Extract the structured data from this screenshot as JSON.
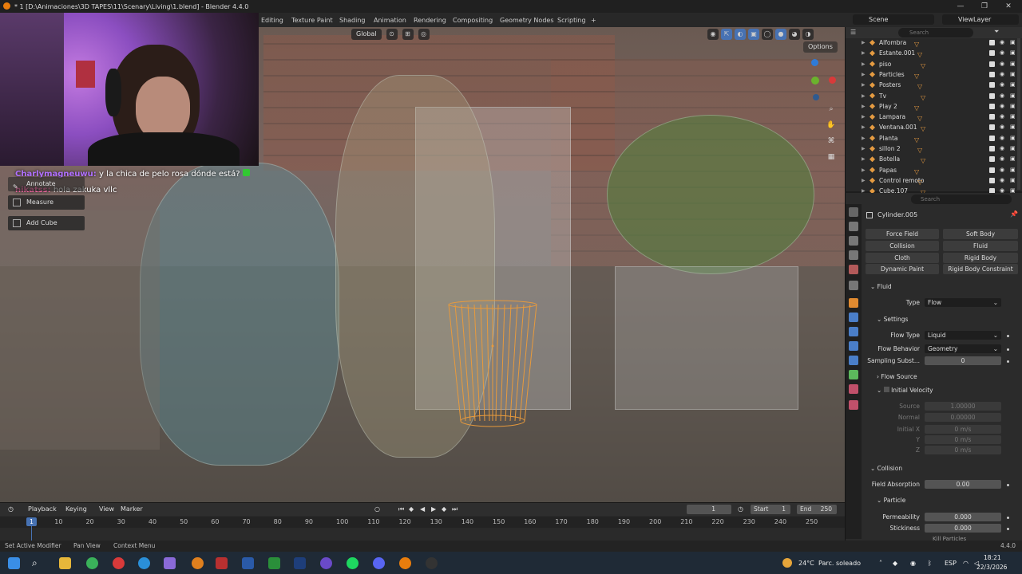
{
  "window": {
    "title": "* 1 [D:\\Animaciones\\3D TAPES\\11\\Scenary\\Living\\1.blend] - Blender 4.4.0",
    "minimize": "—",
    "maximize": "❐",
    "close": "✕"
  },
  "workspaces": [
    "Editing",
    "Texture Paint",
    "Shading",
    "Animation",
    "Rendering",
    "Compositing",
    "Geometry Nodes",
    "Scripting",
    "+"
  ],
  "scene": {
    "scene_name": "Scene",
    "view_layer": "ViewLayer"
  },
  "viewport": {
    "transform_orientation": "Global",
    "options_label": "Options"
  },
  "tools": {
    "annotate": "Annotate",
    "measure": "Measure",
    "add_cube": "Add Cube"
  },
  "chat": [
    {
      "user": "Charlymagneuwu:",
      "message": "y la chica de pelo rosa dónde está?"
    },
    {
      "user": "hikatss:",
      "message": "hola zakuka vllc"
    }
  ],
  "outliner": {
    "search_placeholder": "Search",
    "items": [
      {
        "name": "Alfombra"
      },
      {
        "name": "Estante.001"
      },
      {
        "name": "piso"
      },
      {
        "name": "Particles"
      },
      {
        "name": "Posters"
      },
      {
        "name": "Tv"
      },
      {
        "name": "Play 2"
      },
      {
        "name": "Lampara"
      },
      {
        "name": "Ventana.001"
      },
      {
        "name": "Planta"
      },
      {
        "name": "sillon 2"
      },
      {
        "name": "Botella"
      },
      {
        "name": "Papas"
      },
      {
        "name": "Control remoto"
      },
      {
        "name": "Cube.107"
      }
    ]
  },
  "properties": {
    "search_placeholder": "Search",
    "object_name": "Cylinder.005",
    "physics_buttons": {
      "force_field": "Force Field",
      "soft_body": "Soft Body",
      "collision": "Collision",
      "fluid": "Fluid",
      "cloth": "Cloth",
      "rigid_body": "Rigid Body",
      "dynamic_paint": "Dynamic Paint",
      "rigid_body_constraint": "Rigid Body Constraint"
    },
    "fluid_section": "Fluid",
    "type_label": "Type",
    "type_value": "Flow",
    "settings_section": "Settings",
    "flow_type_label": "Flow Type",
    "flow_type_value": "Liquid",
    "flow_behavior_label": "Flow Behavior",
    "flow_behavior_value": "Geometry",
    "sampling_label": "Sampling Subst...",
    "sampling_value": "0",
    "flow_source_section": "Flow Source",
    "initial_velocity_section": "Initial Velocity",
    "source_label": "Source",
    "source_value": "1.00000",
    "normal_label": "Normal",
    "normal_value": "0.00000",
    "initial_x_label": "Initial X",
    "initial_x_value": "0 m/s",
    "y_label": "Y",
    "y_value": "0 m/s",
    "z_label": "Z",
    "z_value": "0 m/s",
    "collision_section": "Collision",
    "field_absorption_label": "Field Absorption",
    "field_absorption_value": "0.00",
    "particle_section": "Particle",
    "permeability_label": "Permeability",
    "permeability_value": "0.000",
    "stickiness_label": "Stickiness",
    "stickiness_value": "0.000",
    "kill_particles_label": "Kill Particles"
  },
  "timeline": {
    "playback": "Playback",
    "keying": "Keying",
    "view": "View",
    "marker": "Marker",
    "current_frame": "1",
    "start_label": "Start",
    "start_value": "1",
    "end_label": "End",
    "end_value": "250",
    "ticks": [
      "10",
      "20",
      "30",
      "40",
      "50",
      "60",
      "70",
      "80",
      "90",
      "100",
      "110",
      "120",
      "130",
      "140",
      "150",
      "160",
      "170",
      "180",
      "190",
      "200",
      "210",
      "220",
      "230",
      "240",
      "250"
    ],
    "playhead": "1"
  },
  "statusbar": {
    "set_active_modifier": "Set Active Modifier",
    "pan_view": "Pan View",
    "context_menu": "Context Menu",
    "version": "4.4.0"
  },
  "taskbar": {
    "weather_temp": "24°C",
    "weather_desc": "Parc. soleado",
    "language": "ESP",
    "time": "18:21",
    "date": "22/3/2026"
  }
}
